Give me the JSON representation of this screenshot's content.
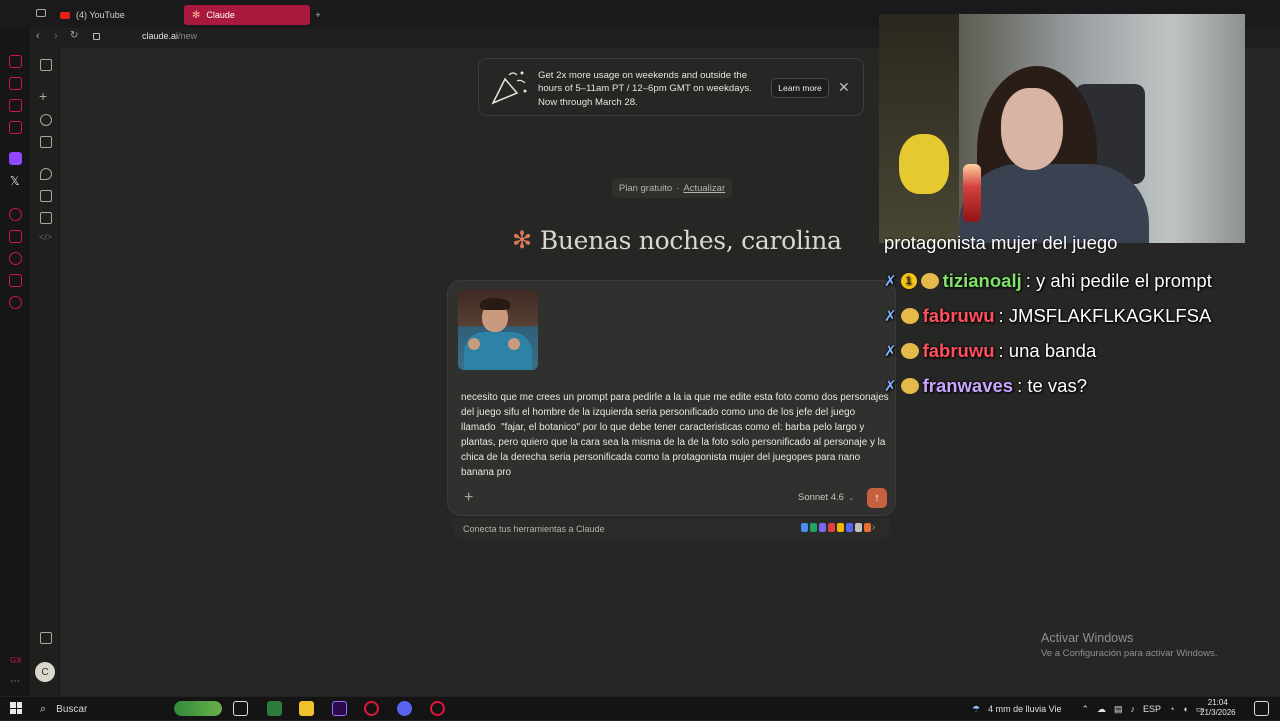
{
  "browser": {
    "tabs": [
      {
        "label": "(4) YouTube"
      },
      {
        "label": "Claude"
      }
    ],
    "new_tab": "+",
    "url_host": "claude.ai",
    "url_path": "/new"
  },
  "banner": {
    "text": "Get 2x more usage on weekends and outside the hours of 5–11am PT / 12–6pm GMT on weekdays. Now through March 28.",
    "learn_more": "Learn more",
    "close": "✕"
  },
  "plan": {
    "label": "Plan gratuito",
    "separator": "·",
    "upgrade": "Actualizar"
  },
  "greeting": {
    "icon": "✻",
    "text": "Buenas noches, carolina"
  },
  "composer": {
    "prompt": "necesito que me crees un prompt para pedirle a la ia que me edite esta foto como dos personajes del juego sifu el hombre de la izquierda seria personificado como uno de los jefe del juego llamado  \"fajar, el botanico\" por lo que debe tener caracteristicas como el: barba pelo largo y plantas, pero quiero que la cara sea la misma de la de la foto solo personificado al personaje y la chica de la derecha seria personificada como la protagonista mujer del juegopes para nano banana pro",
    "plus": "+",
    "model": "Sonnet 4.6",
    "model_chevron": "⌄",
    "send": "↑"
  },
  "connect": {
    "text": "Conecta tus herramientas a Claude",
    "chevron": "›",
    "icon_colors": [
      "#4a8df0",
      "#1fa463",
      "#7b68ee",
      "#e04040",
      "#f2b705",
      "#5865f2",
      "#c0c0c0",
      "#e56f2d"
    ]
  },
  "activate_windows": {
    "title": "Activar Windows",
    "subtitle": "Ve a Configuración para activar Windows."
  },
  "chat": {
    "partial": "protagonista mujer del juego",
    "messages": [
      {
        "user": "tizianoalj",
        "text": ": y ahi pedile el prompt",
        "color": "#7fe36a"
      },
      {
        "user": "fabruwu",
        "text": ": JMSFLAKFLKAGKLFSA",
        "color": "#ff4f5e"
      },
      {
        "user": "fabruwu",
        "text": ": una banda",
        "color": "#ff4f5e"
      },
      {
        "user": "franwaves",
        "text": ": te vas?",
        "color": "#c7a6ff"
      }
    ]
  },
  "taskbar": {
    "search": "Buscar",
    "weather": "4 mm de lluvia Vie",
    "lang": "ESP",
    "time": "21:04",
    "date": "21/3/2026"
  },
  "colors": {
    "accent": "#d97757",
    "opera_red": "#d01843",
    "send": "#c6613f"
  }
}
